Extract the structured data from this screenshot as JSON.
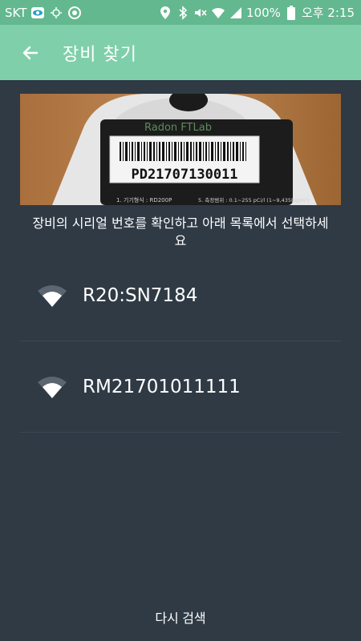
{
  "status_bar": {
    "carrier": "SKT",
    "battery": "100%",
    "time": "오후 2:15",
    "icons": [
      "eye-icon",
      "sync-icon",
      "alarm-icon",
      "location-icon",
      "bluetooth-icon",
      "mute-icon",
      "wifi-icon",
      "signal-icon",
      "battery-icon"
    ]
  },
  "app_bar": {
    "title": "장비 찾기",
    "back_icon": "arrow-left-icon"
  },
  "photo": {
    "brand": "Radon FTLab",
    "serial": "PD21707130011",
    "label_left": "1. 기기형식 : RD200P",
    "label_right": "5. 측정범위 : 0.1~255 pCi/l (1~9,435Bq/m³)"
  },
  "instruction": "장비의 시리얼 번호를 확인하고 아래 목록에서 선택하세요",
  "devices": [
    {
      "name": "R20:SN7184"
    },
    {
      "name": "RM21701011111"
    }
  ],
  "rescan_label": "다시 검색",
  "colors": {
    "status_bar": "#63b88f",
    "app_bar": "#7fd0aa",
    "background": "#2f3a45"
  }
}
